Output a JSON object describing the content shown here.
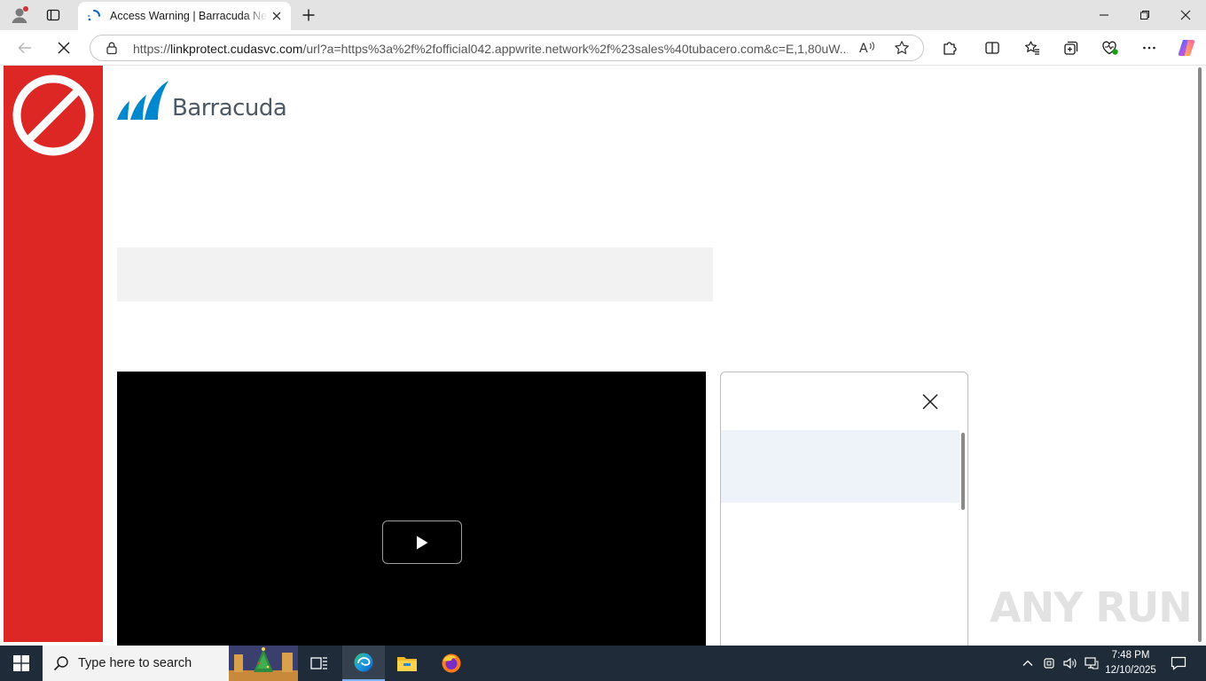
{
  "browser": {
    "tab": {
      "title": "Access Warning | Barracuda Netw",
      "loading": true
    },
    "address_bar": {
      "url_prefix": "https://",
      "url_domain": "linkprotect.cudasvc.com",
      "url_rest": "/url?a=https%3a%2f%2fofficial042.appwrite.network%2f%23sales%40tubacero.com&c=E,1,80uW..."
    },
    "icons": [
      "profile-icon",
      "tab-actions-icon",
      "spinner-icon",
      "close-tab-icon",
      "new-tab-icon",
      "minimize-icon",
      "restore-icon",
      "close-window-icon",
      "back-icon",
      "stop-loading-icon",
      "site-info-icon",
      "read-aloud-icon",
      "favorite-star-icon",
      "extensions-icon",
      "split-screen-icon",
      "favorites-icon",
      "collections-icon",
      "browser-essentials-icon",
      "more-options-icon",
      "copilot-icon"
    ]
  },
  "page": {
    "brand": {
      "logo_text": "Barracuda"
    },
    "colors": {
      "warning_red": "#dd2725",
      "brand_blue": "#0088ce",
      "gray_box": "#f2f2f2",
      "panel_band": "#eef3fa"
    },
    "watermark": "ANY RUN"
  },
  "taskbar": {
    "search_placeholder": "Type here to search",
    "apps": [
      "task-view-icon",
      "edge-icon",
      "file-explorer-icon",
      "firefox-icon"
    ],
    "clock": {
      "time": "7:48 PM",
      "date": "12/10/2025"
    }
  }
}
